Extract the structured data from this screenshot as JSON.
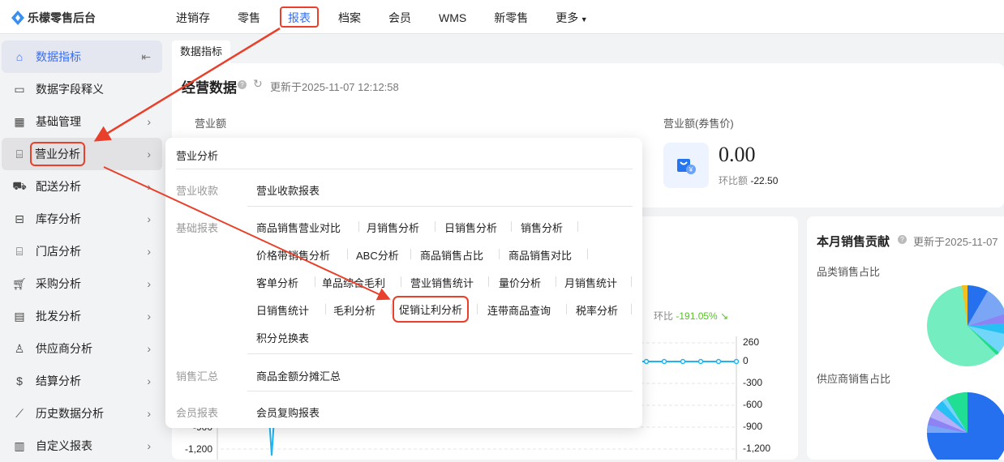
{
  "app": {
    "title": "乐檬零售后台"
  },
  "nav": [
    "进销存",
    "零售",
    "报表",
    "档案",
    "会员",
    "WMS",
    "新零售",
    "更多"
  ],
  "nav_active": "报表",
  "sidebar": {
    "items": [
      {
        "label": "数据指标",
        "icon": "home-icon"
      },
      {
        "label": "数据字段释义",
        "icon": "book-icon"
      },
      {
        "label": "基础管理",
        "icon": "grid-icon"
      },
      {
        "label": "营业分析",
        "icon": "store-icon"
      },
      {
        "label": "配送分析",
        "icon": "truck-icon"
      },
      {
        "label": "库存分析",
        "icon": "inventory-icon"
      },
      {
        "label": "门店分析",
        "icon": "shop-icon"
      },
      {
        "label": "采购分析",
        "icon": "cart-icon"
      },
      {
        "label": "批发分析",
        "icon": "wholesale-icon"
      },
      {
        "label": "供应商分析",
        "icon": "user-icon"
      },
      {
        "label": "结算分析",
        "icon": "dollar-icon"
      },
      {
        "label": "历史数据分析",
        "icon": "chart-line-icon"
      },
      {
        "label": "自定义报表",
        "icon": "bar-chart-icon"
      }
    ]
  },
  "tab": "数据指标",
  "business": {
    "title": "经营数据",
    "updated": "更新于2025-11-07 12:12:58",
    "revenue_label": "营业额",
    "coupon_label": "营业额(券售价)",
    "coupon_value": "0.00",
    "coupon_compare_label": "环比额",
    "coupon_compare_value": "-22.50"
  },
  "trend": {
    "compare_label": "环比",
    "compare_value": "-191.05%",
    "right_axis": [
      "260",
      "0",
      "-300",
      "-600",
      "-900",
      "-1,200"
    ],
    "left_axis": [
      "-900",
      "-1,200"
    ]
  },
  "contribution": {
    "title": "本月销售贡献",
    "updated": "更新于2025-11-07",
    "category_label": "品类销售占比",
    "supplier_label": "供应商销售占比"
  },
  "popup": {
    "title": "营业分析",
    "groups": [
      {
        "name": "营业收款",
        "links": [
          "营业收款报表"
        ]
      },
      {
        "name": "基础报表",
        "links": [
          "商品销售营业对比",
          "月销售分析",
          "日销售分析",
          "销售分析",
          "价格带销售分析",
          "ABC分析",
          "商品销售占比",
          "商品销售对比",
          "客单分析",
          "单品综合毛利",
          "营业销售统计",
          "量价分析",
          "月销售统计",
          "日销售统计",
          "毛利分析",
          "促销让利分析",
          "连带商品查询",
          "税率分析",
          "积分兑换表"
        ]
      },
      {
        "name": "销售汇总",
        "links": [
          "商品金额分摊汇总"
        ]
      },
      {
        "name": "会员报表",
        "links": [
          "会员复购报表"
        ]
      }
    ]
  },
  "colors": {
    "accent": "#3a6df0",
    "highlight": "#e8402a",
    "down": "#52c41a"
  }
}
